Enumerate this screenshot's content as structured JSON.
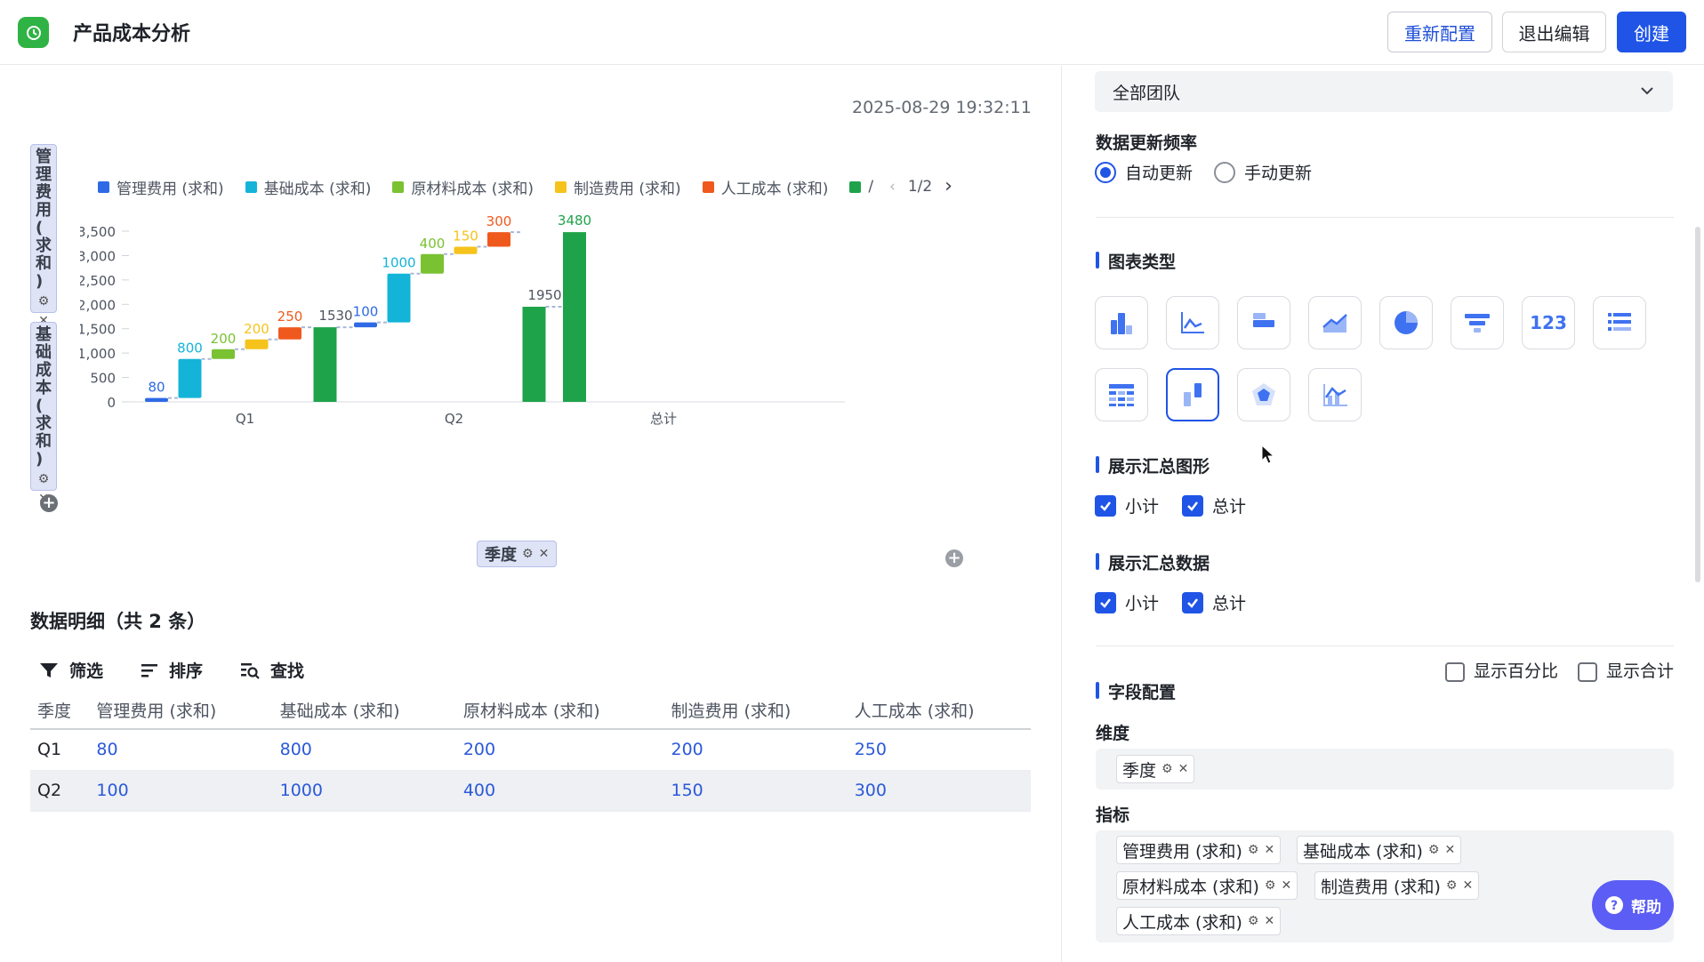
{
  "header": {
    "title": "产品成本分析",
    "reconfig_label": "重新配置",
    "exit_label": "退出编辑",
    "create_label": "创建"
  },
  "chart_panel": {
    "timestamp": "2025-08-29 19:32:11",
    "row_tags": [
      {
        "label": "管理费用(求和)"
      },
      {
        "label": "基础成本(求和)"
      }
    ],
    "dimension_tag": "季度",
    "legend": {
      "items": [
        "管理费用 (求和)",
        "基础成本 (求和)",
        "原材料成本 (求和)",
        "制造费用 (求和)",
        "人工成本 (求和)",
        "/"
      ],
      "page": "1/2"
    }
  },
  "chart_data": {
    "type": "bar",
    "subtype": "waterfall",
    "categories": [
      "Q1",
      "Q2",
      "总计"
    ],
    "series": [
      {
        "name": "管理费用 (求和)",
        "color": "#2e6ae6",
        "values": [
          80,
          100
        ]
      },
      {
        "name": "基础成本 (求和)",
        "color": "#14b4d8",
        "values": [
          800,
          1000
        ]
      },
      {
        "name": "原材料成本 (求和)",
        "color": "#7ac232",
        "values": [
          200,
          400
        ]
      },
      {
        "name": "制造费用 (求和)",
        "color": "#f5c31c",
        "values": [
          200,
          150
        ]
      },
      {
        "name": "人工成本 (求和)",
        "color": "#f0591e",
        "values": [
          250,
          300
        ]
      }
    ],
    "subtotals": {
      "color": "#1fa34a",
      "values": [
        1530,
        1950
      ]
    },
    "total": {
      "color": "#1fa34a",
      "value": 3480
    },
    "data_labels": [
      "80",
      "800",
      "200",
      "200",
      "250",
      "1530",
      "100",
      "1000",
      "400",
      "150",
      "300",
      "1950",
      "3480"
    ],
    "y_ticks": [
      "0",
      "500",
      "1,000",
      "1,500",
      "2,000",
      "2,500",
      "3,000",
      "3,500"
    ],
    "ylim": [
      0,
      3500
    ],
    "legend_position": "top"
  },
  "table": {
    "title": "数据明细（共 2 条）",
    "tools": {
      "filter": "筛选",
      "sort": "排序",
      "find": "查找"
    },
    "show_percent": "显示百分比",
    "show_total": "显示合计",
    "columns": [
      "季度",
      "管理费用 (求和)",
      "基础成本 (求和)",
      "原材料成本 (求和)",
      "制造费用 (求和)",
      "人工成本 (求和)"
    ],
    "rows": [
      [
        "Q1",
        "80",
        "800",
        "200",
        "200",
        "250"
      ],
      [
        "Q2",
        "100",
        "1000",
        "400",
        "150",
        "300"
      ]
    ]
  },
  "settings": {
    "team_select": "全部团队",
    "update_freq_label": "数据更新频率",
    "auto_update": "自动更新",
    "manual_update": "手动更新",
    "chart_type_label": "图表类型",
    "chart_types": [
      "column-icon",
      "line-icon",
      "bar-icon",
      "area-icon",
      "pie-icon",
      "funnel-icon",
      "number-icon",
      "list-icon",
      "table-icon",
      "waterfall-icon",
      "radar-icon",
      "dual-axis-icon"
    ],
    "number_icon_text": "123",
    "summary_shape_label": "展示汇总图形",
    "summary_data_label": "展示汇总数据",
    "subtotal": "小计",
    "total": "总计",
    "field_config_label": "字段配置",
    "dimension_label": "维度",
    "dimension_chip": "季度",
    "metric_label": "指标",
    "metric_chips": [
      "管理费用 (求和)",
      "基础成本 (求和)",
      "原材料成本 (求和)",
      "制造费用 (求和)",
      "人工成本 (求和)"
    ]
  },
  "help_label": "帮助"
}
